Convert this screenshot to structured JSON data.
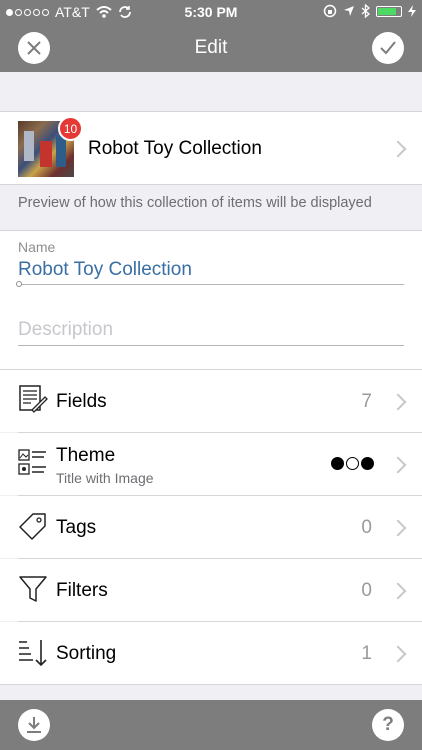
{
  "status_bar": {
    "carrier": "AT&T",
    "time": "5:30 PM"
  },
  "nav": {
    "title": "Edit",
    "close_icon": "close-icon",
    "confirm_icon": "checkmark-icon"
  },
  "collection": {
    "title": "Robot Toy Collection",
    "badge": "10"
  },
  "preview_note": "Preview of how this collection of items will be displayed",
  "form": {
    "name_label": "Name",
    "name_value": "Robot Toy Collection",
    "description_placeholder": "Description"
  },
  "rows": [
    {
      "label": "Fields",
      "value": "7",
      "icon": "fields-icon"
    },
    {
      "label": "Theme",
      "subtitle": "Title with Image",
      "icon": "theme-icon",
      "value_icon": "theme-dots-icon"
    },
    {
      "label": "Tags",
      "value": "0",
      "icon": "tag-icon"
    },
    {
      "label": "Filters",
      "value": "0",
      "icon": "filter-icon"
    },
    {
      "label": "Sorting",
      "value": "1",
      "icon": "sort-icon"
    }
  ],
  "bottom_bar": {
    "left_icon": "download-icon",
    "right_icon": "help-icon",
    "help_label": "?"
  }
}
